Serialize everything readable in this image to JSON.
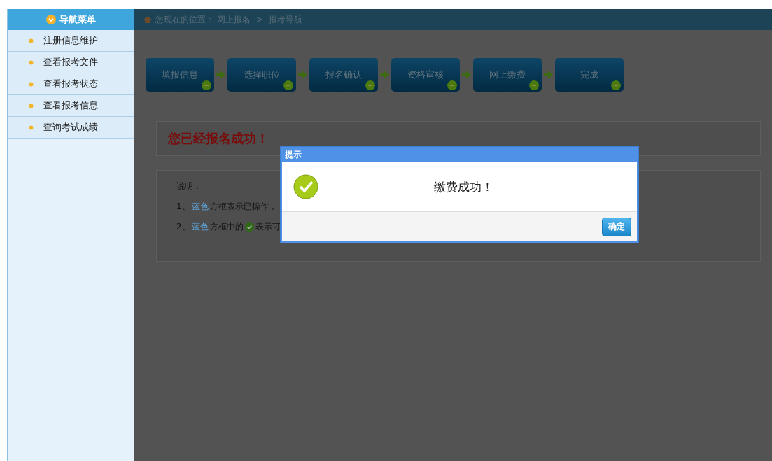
{
  "sidebar": {
    "title": "导航菜单",
    "items": [
      {
        "label": "注册信息维护"
      },
      {
        "label": "查看报考文件"
      },
      {
        "label": "查看报考状态"
      },
      {
        "label": "查看报考信息"
      },
      {
        "label": "查询考试成绩"
      }
    ]
  },
  "breadcrumb": {
    "prefix": "您现在的位置：",
    "items": [
      "网上报名",
      "报考导航"
    ],
    "separator": ">"
  },
  "steps": [
    {
      "label": "填报信息"
    },
    {
      "label": "选择职位"
    },
    {
      "label": "报名确认"
    },
    {
      "label": "资格审核"
    },
    {
      "label": "网上缴费"
    },
    {
      "label": "完成"
    }
  ],
  "success_message": "您已经报名成功！",
  "notes": {
    "title": "说明：",
    "lines": [
      [
        {
          "kind": "text",
          "text": "1、"
        },
        {
          "kind": "blue",
          "text": "蓝色"
        },
        {
          "kind": "text",
          "text": "方框表示已操作，"
        }
      ],
      [
        {
          "kind": "text",
          "text": "2、"
        },
        {
          "kind": "blue",
          "text": "蓝色"
        },
        {
          "kind": "text",
          "text": "方框中的"
        },
        {
          "kind": "icon"
        },
        {
          "kind": "text",
          "text": "表示可"
        }
      ]
    ]
  },
  "dialog": {
    "title": "提示",
    "message": "缴费成功！",
    "button": "确定"
  }
}
